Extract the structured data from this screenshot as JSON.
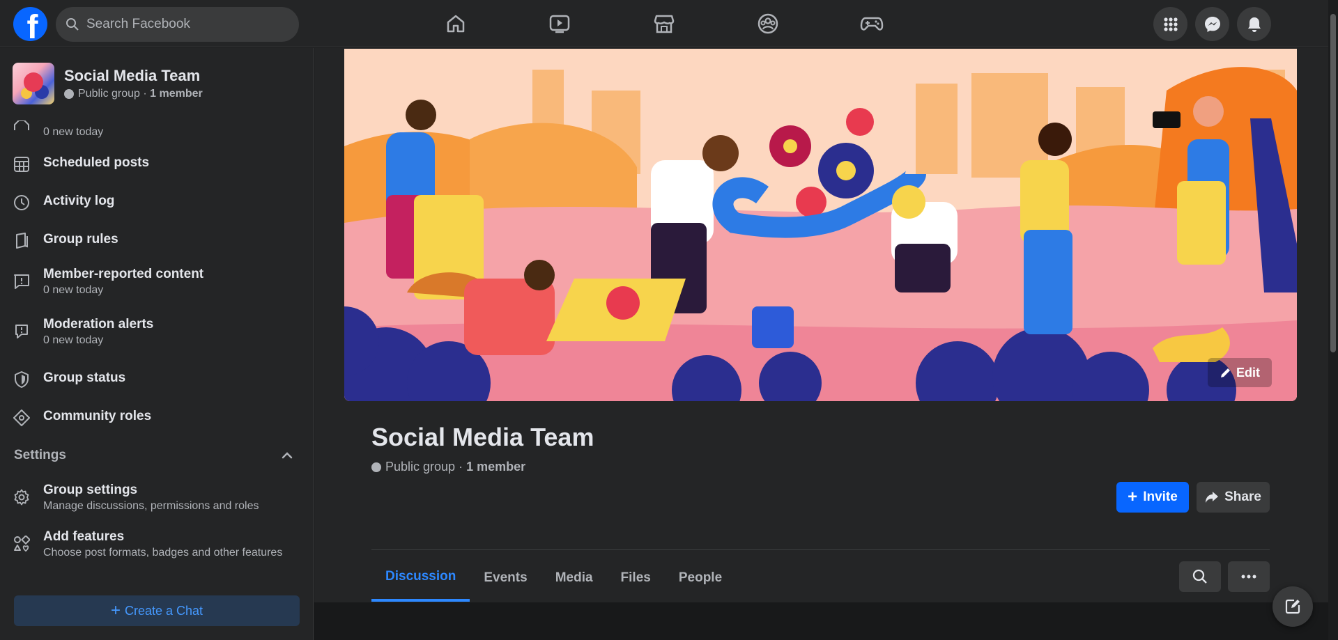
{
  "topbar": {
    "search_placeholder": "Search Facebook",
    "nav_icons": [
      "home-icon",
      "watch-icon",
      "marketplace-icon",
      "groups-icon",
      "gaming-icon"
    ],
    "right_icons": [
      "menu-grid-icon",
      "messenger-icon",
      "notifications-icon"
    ],
    "brand_color": "#0866ff"
  },
  "sidebar": {
    "group_name": "Social Media Team",
    "group_privacy": "Public group ·",
    "group_members": "1 member",
    "items": [
      {
        "icon": "pending-icon",
        "label": "",
        "sub": "0 new today"
      },
      {
        "icon": "calendar-grid-icon",
        "label": "Scheduled posts",
        "sub": ""
      },
      {
        "icon": "clock-icon",
        "label": "Activity log",
        "sub": ""
      },
      {
        "icon": "book-icon",
        "label": "Group rules",
        "sub": ""
      },
      {
        "icon": "report-icon",
        "label": "Member-reported content",
        "sub": "0 new today"
      },
      {
        "icon": "alert-speech-icon",
        "label": "Moderation alerts",
        "sub": "0 new today"
      },
      {
        "icon": "shield-icon",
        "label": "Group status",
        "sub": ""
      },
      {
        "icon": "diamond-icon",
        "label": "Community roles",
        "sub": ""
      }
    ],
    "settings_heading": "Settings",
    "settings_items": [
      {
        "icon": "gear-icon",
        "label": "Group settings",
        "sub": "Manage discussions, permissions and roles"
      },
      {
        "icon": "shapes-icon",
        "label": "Add features",
        "sub": "Choose post formats, badges and other features"
      }
    ],
    "create_chat": "Create a Chat"
  },
  "main": {
    "edit_label": "Edit",
    "title": "Social Media Team",
    "privacy": "Public group ·",
    "members": "1 member",
    "invite_label": "Invite",
    "share_label": "Share",
    "tabs": [
      "Discussion",
      "Events",
      "Media",
      "Files",
      "People"
    ],
    "active_tab": "Discussion"
  }
}
